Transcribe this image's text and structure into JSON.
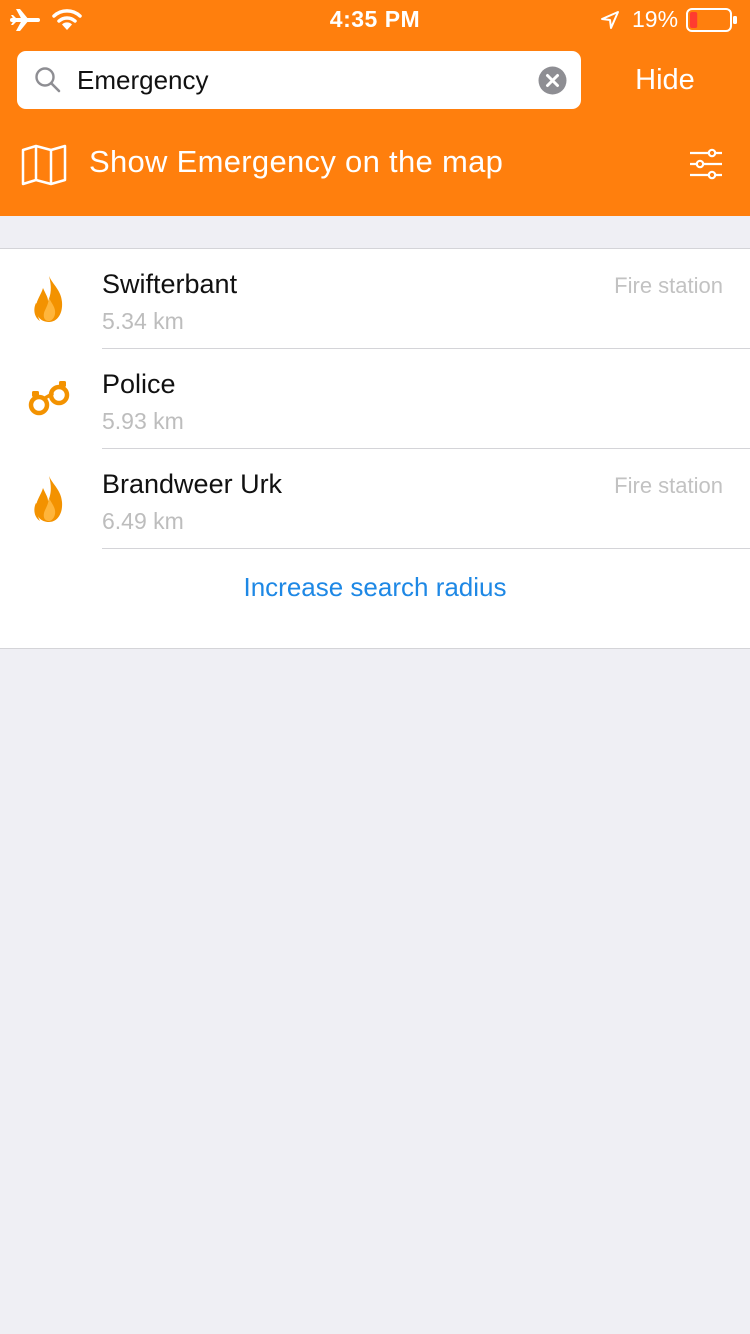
{
  "status_bar": {
    "time": "4:35 PM",
    "battery_percent": "19%",
    "battery_level": 0.19,
    "icons": [
      "airplane-icon",
      "wifi-icon",
      "location-arrow-icon",
      "battery-icon"
    ]
  },
  "search": {
    "value": "Emergency",
    "placeholder": "Search"
  },
  "header": {
    "hide_label": "Hide",
    "map_label": "Show Emergency on the map",
    "background_color": "#FF7F0D"
  },
  "results": [
    {
      "title": "Swifterbant",
      "distance": "5.34 km",
      "type": "Fire station",
      "icon": "fire-icon"
    },
    {
      "title": "Police",
      "distance": "5.93 km",
      "type": "",
      "icon": "handcuffs-icon"
    },
    {
      "title": "Brandweer Urk",
      "distance": "6.49 km",
      "type": "Fire station",
      "icon": "fire-icon"
    }
  ],
  "increase_radius_label": "Increase search radius",
  "colors": {
    "accent": "#FF7F0D",
    "link": "#1E88E5",
    "background": "#EFEFF4",
    "icon": "#F39200"
  }
}
